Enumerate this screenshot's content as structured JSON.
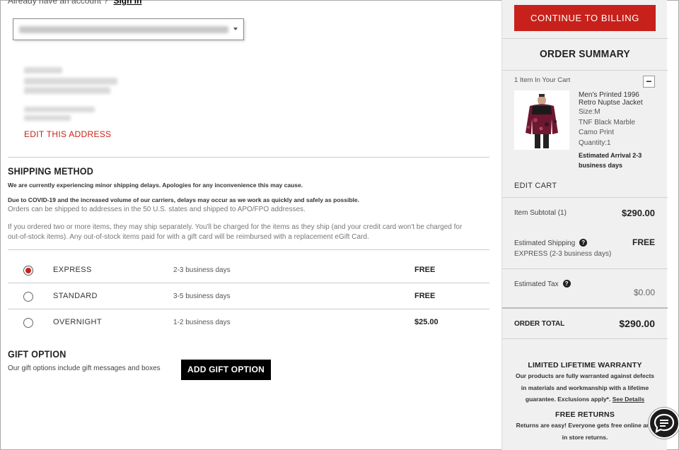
{
  "account": {
    "prompt": "Already have an account ?",
    "signin_label": "Sign In"
  },
  "address": {
    "edit_label": "EDIT THIS ADDRESS"
  },
  "shipping": {
    "title": "SHIPPING METHOD",
    "notice_1": "We are currently experiencing minor shipping delays. Apologies for any inconvenience this may cause.",
    "notice_2": "Due to COVID-19 and the increased volume of our carriers, delays may occur as we work as quickly and safely as possible.",
    "notice_3": "Orders can be shipped to addresses in the 50 U.S. states and shipped to APO/FPO addresses.",
    "notice_4a": "If you ordered two or more items, they may ship separately. You'll be charged for the items as they ship (and your credit card won't be charged for",
    "notice_4b": "out-of-stock items). Any out-of-stock items paid for with a gift card will be reimbursed with a replacement eGift Card.",
    "options": [
      {
        "name": "EXPRESS",
        "days": "2-3 business days",
        "price": "FREE",
        "selected": true
      },
      {
        "name": "STANDARD",
        "days": "3-5 business days",
        "price": "FREE",
        "selected": false
      },
      {
        "name": "OVERNIGHT",
        "days": "1-2 business days",
        "price": "$25.00",
        "selected": false
      }
    ]
  },
  "gift": {
    "title": "GIFT OPTION",
    "description": "Our gift options include gift messages and boxes",
    "button_label": "ADD GIFT OPTION"
  },
  "summary": {
    "billing_button": "CONTINUE TO BILLING",
    "title": "ORDER SUMMARY",
    "items_in_cart": "1 Item In Your Cart",
    "collapse_symbol": "−",
    "product": {
      "name": "Men's Printed 1996 Retro Nuptse Jacket",
      "size": "Size:M",
      "color_1": "TNF Black Marble",
      "color_2": "Camo Print",
      "quantity": "Quantity:1",
      "arrival": "Estimated Arrival 2-3 business days"
    },
    "edit_cart": "EDIT CART",
    "subtotal_label": "Item Subtotal (1)",
    "subtotal_value": "$290.00",
    "shipping_label": "Estimated Shipping",
    "shipping_value": "FREE",
    "shipping_method": "EXPRESS (2-3 business days)",
    "tax_label": "Estimated Tax",
    "tax_value": "$0.00",
    "total_label": "ORDER TOTAL",
    "total_value": "$290.00",
    "warranty_title": "LIMITED LIFETIME WARRANTY",
    "warranty_text": "Our products are fully warranted against defects in materials and workmanship with a lifetime guarantee. Exclusions apply*.",
    "warranty_link": "See Details",
    "returns_title": "FREE RETURNS",
    "returns_text": "Returns are easy! Everyone gets free online and in store returns."
  },
  "colors": {
    "accent": "#c8211b",
    "panel": "#f0f0f0"
  },
  "icons": {
    "help": "question-icon",
    "chat": "chat-icon"
  }
}
